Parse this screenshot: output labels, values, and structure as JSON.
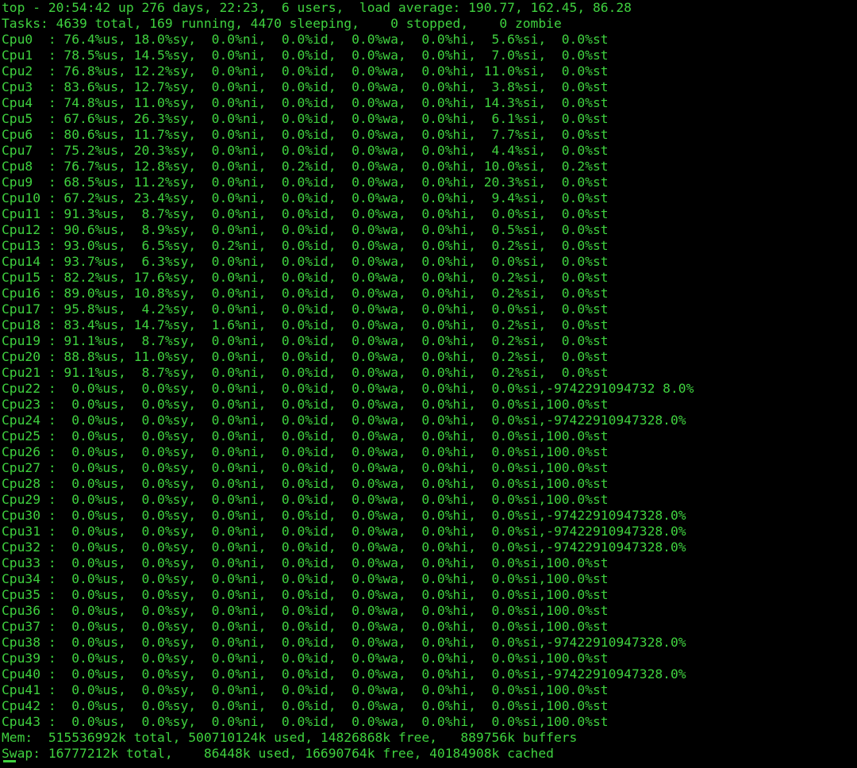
{
  "terminal": {
    "colors": {
      "background": "#000000",
      "text": "#3fd13f"
    },
    "header": [
      "top - 20:54:42 up 276 days, 22:23,  6 users,  load average: 190.77, 162.45, 86.28",
      "Tasks: 4639 total, 169 running, 4470 sleeping,    0 stopped,    0 zombie"
    ],
    "cpus": [
      "Cpu0  : 76.4%us, 18.0%sy,  0.0%ni,  0.0%id,  0.0%wa,  0.0%hi,  5.6%si,  0.0%st",
      "Cpu1  : 78.5%us, 14.5%sy,  0.0%ni,  0.0%id,  0.0%wa,  0.0%hi,  7.0%si,  0.0%st",
      "Cpu2  : 76.8%us, 12.2%sy,  0.0%ni,  0.0%id,  0.0%wa,  0.0%hi, 11.0%si,  0.0%st",
      "Cpu3  : 83.6%us, 12.7%sy,  0.0%ni,  0.0%id,  0.0%wa,  0.0%hi,  3.8%si,  0.0%st",
      "Cpu4  : 74.8%us, 11.0%sy,  0.0%ni,  0.0%id,  0.0%wa,  0.0%hi, 14.3%si,  0.0%st",
      "Cpu5  : 67.6%us, 26.3%sy,  0.0%ni,  0.0%id,  0.0%wa,  0.0%hi,  6.1%si,  0.0%st",
      "Cpu6  : 80.6%us, 11.7%sy,  0.0%ni,  0.0%id,  0.0%wa,  0.0%hi,  7.7%si,  0.0%st",
      "Cpu7  : 75.2%us, 20.3%sy,  0.0%ni,  0.0%id,  0.0%wa,  0.0%hi,  4.4%si,  0.0%st",
      "Cpu8  : 76.7%us, 12.8%sy,  0.0%ni,  0.2%id,  0.0%wa,  0.0%hi, 10.0%si,  0.2%st",
      "Cpu9  : 68.5%us, 11.2%sy,  0.0%ni,  0.0%id,  0.0%wa,  0.0%hi, 20.3%si,  0.0%st",
      "Cpu10 : 67.2%us, 23.4%sy,  0.0%ni,  0.0%id,  0.0%wa,  0.0%hi,  9.4%si,  0.0%st",
      "Cpu11 : 91.3%us,  8.7%sy,  0.0%ni,  0.0%id,  0.0%wa,  0.0%hi,  0.0%si,  0.0%st",
      "Cpu12 : 90.6%us,  8.9%sy,  0.0%ni,  0.0%id,  0.0%wa,  0.0%hi,  0.5%si,  0.0%st",
      "Cpu13 : 93.0%us,  6.5%sy,  0.2%ni,  0.0%id,  0.0%wa,  0.0%hi,  0.2%si,  0.0%st",
      "Cpu14 : 93.7%us,  6.3%sy,  0.0%ni,  0.0%id,  0.0%wa,  0.0%hi,  0.0%si,  0.0%st",
      "Cpu15 : 82.2%us, 17.6%sy,  0.0%ni,  0.0%id,  0.0%wa,  0.0%hi,  0.2%si,  0.0%st",
      "Cpu16 : 89.0%us, 10.8%sy,  0.0%ni,  0.0%id,  0.0%wa,  0.0%hi,  0.2%si,  0.0%st",
      "Cpu17 : 95.8%us,  4.2%sy,  0.0%ni,  0.0%id,  0.0%wa,  0.0%hi,  0.0%si,  0.0%st",
      "Cpu18 : 83.4%us, 14.7%sy,  1.6%ni,  0.0%id,  0.0%wa,  0.0%hi,  0.2%si,  0.0%st",
      "Cpu19 : 91.1%us,  8.7%sy,  0.0%ni,  0.0%id,  0.0%wa,  0.0%hi,  0.2%si,  0.0%st",
      "Cpu20 : 88.8%us, 11.0%sy,  0.0%ni,  0.0%id,  0.0%wa,  0.0%hi,  0.2%si,  0.0%st",
      "Cpu21 : 91.1%us,  8.7%sy,  0.0%ni,  0.0%id,  0.0%wa,  0.0%hi,  0.2%si,  0.0%st",
      "Cpu22 :  0.0%us,  0.0%sy,  0.0%ni,  0.0%id,  0.0%wa,  0.0%hi,  0.0%si,-9742291094732 8.0%",
      "Cpu23 :  0.0%us,  0.0%sy,  0.0%ni,  0.0%id,  0.0%wa,  0.0%hi,  0.0%si,100.0%st",
      "Cpu24 :  0.0%us,  0.0%sy,  0.0%ni,  0.0%id,  0.0%wa,  0.0%hi,  0.0%si,-97422910947328.0%",
      "Cpu25 :  0.0%us,  0.0%sy,  0.0%ni,  0.0%id,  0.0%wa,  0.0%hi,  0.0%si,100.0%st",
      "Cpu26 :  0.0%us,  0.0%sy,  0.0%ni,  0.0%id,  0.0%wa,  0.0%hi,  0.0%si,100.0%st",
      "Cpu27 :  0.0%us,  0.0%sy,  0.0%ni,  0.0%id,  0.0%wa,  0.0%hi,  0.0%si,100.0%st",
      "Cpu28 :  0.0%us,  0.0%sy,  0.0%ni,  0.0%id,  0.0%wa,  0.0%hi,  0.0%si,100.0%st",
      "Cpu29 :  0.0%us,  0.0%sy,  0.0%ni,  0.0%id,  0.0%wa,  0.0%hi,  0.0%si,100.0%st",
      "Cpu30 :  0.0%us,  0.0%sy,  0.0%ni,  0.0%id,  0.0%wa,  0.0%hi,  0.0%si,-97422910947328.0%",
      "Cpu31 :  0.0%us,  0.0%sy,  0.0%ni,  0.0%id,  0.0%wa,  0.0%hi,  0.0%si,-97422910947328.0%",
      "Cpu32 :  0.0%us,  0.0%sy,  0.0%ni,  0.0%id,  0.0%wa,  0.0%hi,  0.0%si,-97422910947328.0%",
      "Cpu33 :  0.0%us,  0.0%sy,  0.0%ni,  0.0%id,  0.0%wa,  0.0%hi,  0.0%si,100.0%st",
      "Cpu34 :  0.0%us,  0.0%sy,  0.0%ni,  0.0%id,  0.0%wa,  0.0%hi,  0.0%si,100.0%st",
      "Cpu35 :  0.0%us,  0.0%sy,  0.0%ni,  0.0%id,  0.0%wa,  0.0%hi,  0.0%si,100.0%st",
      "Cpu36 :  0.0%us,  0.0%sy,  0.0%ni,  0.0%id,  0.0%wa,  0.0%hi,  0.0%si,100.0%st",
      "Cpu37 :  0.0%us,  0.0%sy,  0.0%ni,  0.0%id,  0.0%wa,  0.0%hi,  0.0%si,100.0%st",
      "Cpu38 :  0.0%us,  0.0%sy,  0.0%ni,  0.0%id,  0.0%wa,  0.0%hi,  0.0%si,-97422910947328.0%",
      "Cpu39 :  0.0%us,  0.0%sy,  0.0%ni,  0.0%id,  0.0%wa,  0.0%hi,  0.0%si,100.0%st",
      "Cpu40 :  0.0%us,  0.0%sy,  0.0%ni,  0.0%id,  0.0%wa,  0.0%hi,  0.0%si,-97422910947328.0%",
      "Cpu41 :  0.0%us,  0.0%sy,  0.0%ni,  0.0%id,  0.0%wa,  0.0%hi,  0.0%si,100.0%st",
      "Cpu42 :  0.0%us,  0.0%sy,  0.0%ni,  0.0%id,  0.0%wa,  0.0%hi,  0.0%si,100.0%st",
      "Cpu43 :  0.0%us,  0.0%sy,  0.0%ni,  0.0%id,  0.0%wa,  0.0%hi,  0.0%si,100.0%st"
    ],
    "mem": "Mem:  515536992k total, 500710124k used, 14826868k free,   889756k buffers",
    "swap": "Swap: 16777212k total,    86448k used, 16690764k free, 40184908k cached"
  }
}
